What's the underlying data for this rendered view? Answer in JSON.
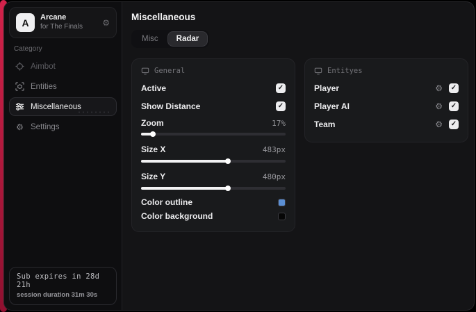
{
  "colors": {
    "accent_red": "#c11c3c",
    "outline_swatch": "#5b8fd4",
    "background_swatch": "#060606"
  },
  "sidebar": {
    "logo_letter": "A",
    "app_name": "Arcane",
    "app_subtitle": "for The Finals",
    "category_label": "Category",
    "items": [
      {
        "label": "Aimbot",
        "active": false
      },
      {
        "label": "Entities",
        "active": false
      },
      {
        "label": "Miscellaneous",
        "active": true
      },
      {
        "label": "Settings",
        "active": false
      }
    ],
    "status_line1": "Sub expires in 28d 21h",
    "status_line2": "session duration 31m 30s"
  },
  "main": {
    "title": "Miscellaneous",
    "tabs": [
      {
        "label": "Misc",
        "active": false
      },
      {
        "label": "Radar",
        "active": true
      }
    ],
    "general": {
      "title": "General",
      "toggles": [
        {
          "label": "Active",
          "checked": true,
          "check_glyph": "✓"
        },
        {
          "label": "Show Distance",
          "checked": true,
          "check_glyph": "✓"
        }
      ],
      "sliders": [
        {
          "label": "Zoom",
          "value": "17%",
          "fill_percent": 8
        },
        {
          "label": "Size X",
          "value": "483px",
          "fill_percent": 60
        },
        {
          "label": "Size Y",
          "value": "480px",
          "fill_percent": 60
        }
      ],
      "color_rows": [
        {
          "label": "Color outline",
          "swatch": "#5b8fd4"
        },
        {
          "label": "Color background",
          "swatch": "#060606"
        }
      ]
    },
    "entities": {
      "title": "Entityes",
      "rows": [
        {
          "label": "Player",
          "checked": true,
          "check_glyph": "✓"
        },
        {
          "label": "Player AI",
          "checked": true,
          "check_glyph": "✓"
        },
        {
          "label": "Team",
          "checked": true,
          "check_glyph": "✓"
        }
      ],
      "gear_glyph": "⚙"
    },
    "gear_glyph": "⚙"
  }
}
